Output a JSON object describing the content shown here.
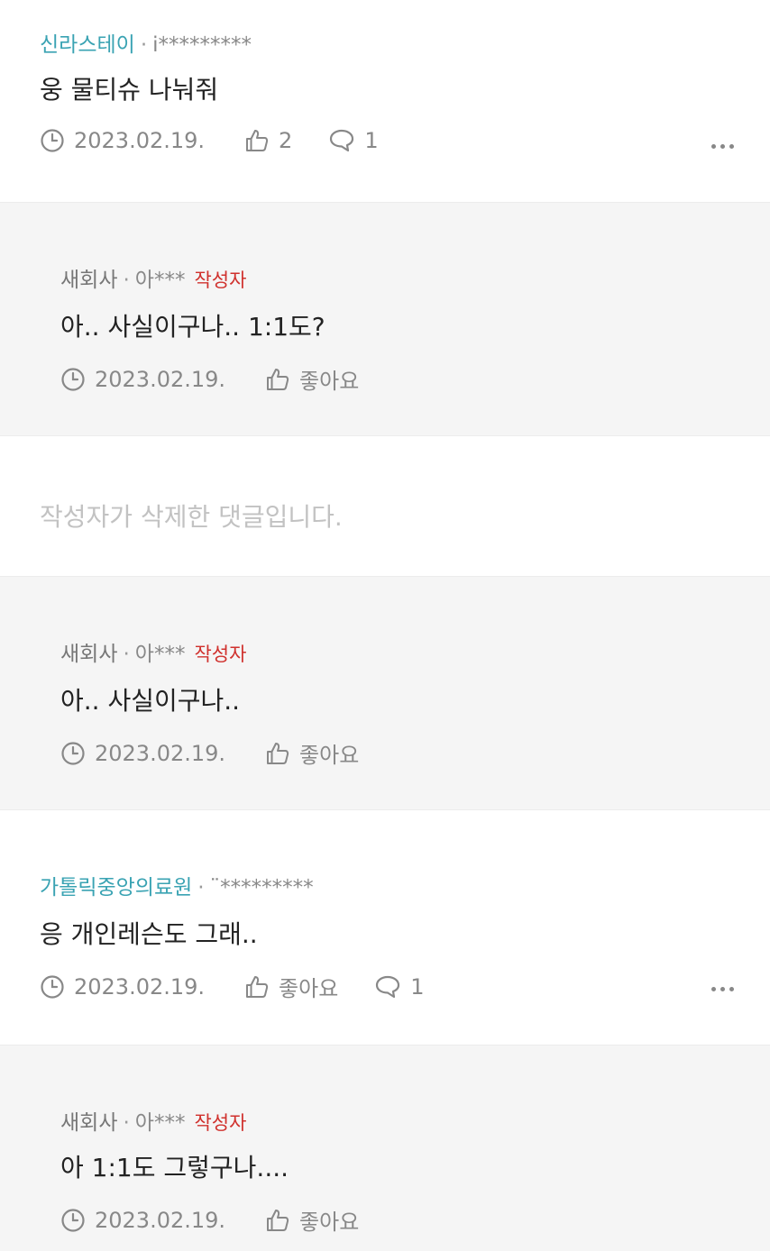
{
  "comments": [
    {
      "company": "신라스테이",
      "user_id": "i*********",
      "text": "웅 물티슈 나눠줘",
      "date": "2023.02.19.",
      "likes": "2",
      "replies": "1"
    },
    {
      "company": "새회사",
      "user_id": "아***",
      "badge": "작성자",
      "text": "아.. 사실이구나.. 1:1도?",
      "date": "2023.02.19.",
      "like_label": "좋아요"
    },
    {
      "deleted_text": "작성자가 삭제한 댓글입니다."
    },
    {
      "company": "새회사",
      "user_id": "아***",
      "badge": "작성자",
      "text": "아.. 사실이구나..",
      "date": "2023.02.19.",
      "like_label": "좋아요"
    },
    {
      "company": "가톨릭중앙의료원",
      "user_id": "¨*********",
      "text": "응 개인레슨도 그래..",
      "date": "2023.02.19.",
      "like_label": "좋아요",
      "replies": "1"
    },
    {
      "company": "새회사",
      "user_id": "아***",
      "badge": "작성자",
      "text": "아 1:1도 그렇구나....",
      "date": "2023.02.19.",
      "like_label": "좋아요"
    }
  ]
}
